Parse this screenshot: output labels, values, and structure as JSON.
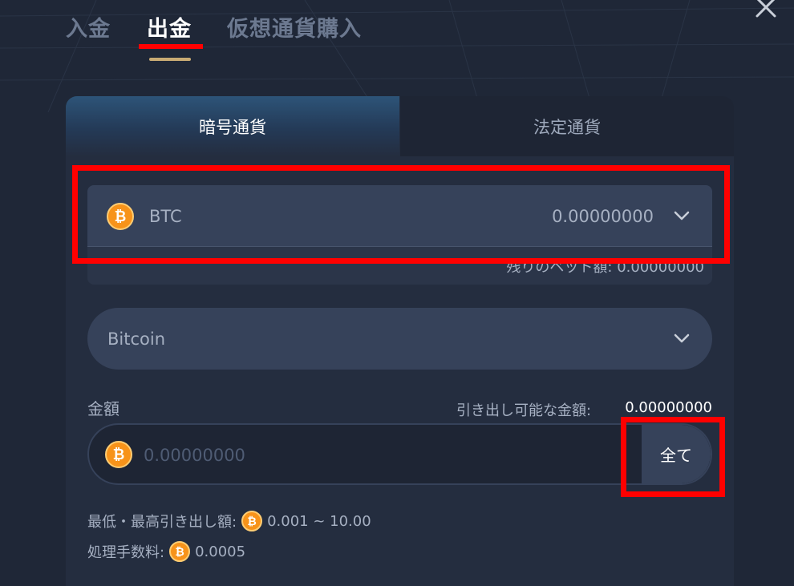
{
  "top_tabs": {
    "deposit": "入金",
    "withdraw": "出金",
    "buy_crypto": "仮想通貨購入"
  },
  "sub_tabs": {
    "crypto": "暗号通貨",
    "fiat": "法定通貨"
  },
  "currency": {
    "code": "BTC",
    "icon": "bitcoin-icon",
    "balance": "0.00000000",
    "bet_remaining": "残りのベット額: 0.00000000"
  },
  "network": {
    "label": "Bitcoin"
  },
  "amount": {
    "label": "金額",
    "available_label": "引き出し可能な金額:",
    "available_value": "0.00000000",
    "placeholder": "0.00000000",
    "all_button": "全て"
  },
  "limits": {
    "label": "最低・最高引き出し額:",
    "value": "0.001 ~ 10.00"
  },
  "fee": {
    "label": "処理手数料:",
    "value": "0.0005"
  },
  "colors": {
    "bitcoin": "#f7931a",
    "highlight": "#ff0000",
    "accent_gold": "#c9ab74"
  }
}
